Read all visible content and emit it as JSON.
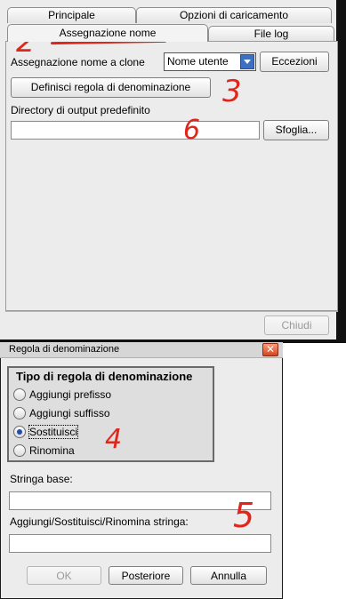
{
  "top_window": {
    "tabs_row1": [
      "Principale",
      "Opzioni di caricamento"
    ],
    "tabs_row2": [
      "Assegnazione nome",
      "File log"
    ],
    "clone_label": "Assegnazione nome a clone",
    "clone_select_value": "Nome utente",
    "exceptions_button": "Eccezioni",
    "define_rule_button": "Definisci regola di denominazione",
    "output_dir_label": "Directory di output predefinito",
    "output_dir_value": "",
    "browse_button": "Sfoglia...",
    "close_button": "Chiudi"
  },
  "dialog": {
    "title": "Regola di denominazione",
    "close_glyph": "✕",
    "group_title": "Tipo di regola di denominazione",
    "options": [
      "Aggiungi prefisso",
      "Aggiungi suffisso",
      "Sostituisci",
      "Rinomina"
    ],
    "selected_index": 2,
    "base_string_label": "Stringa base:",
    "base_string_value": "",
    "modify_string_label": "Aggiungi/Sostituisci/Rinomina stringa:",
    "modify_string_value": "",
    "ok_button": "OK",
    "back_button": "Posteriore",
    "cancel_button": "Annulla"
  },
  "annotations": [
    "2",
    "3",
    "6",
    "4",
    "5"
  ],
  "colors": {
    "annotation": "#e0261a",
    "selected_radio": "#1f4da8",
    "dropdown_arrow": "#3d6fc2"
  }
}
